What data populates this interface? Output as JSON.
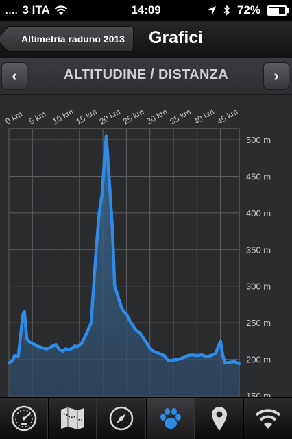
{
  "status": {
    "carrier": "3 ITA",
    "signal_dots": "....",
    "time": "14:09",
    "battery": "72%",
    "battery_level": 0.72
  },
  "navbar": {
    "back_label": "Altimetria raduno 2013",
    "title": "Grafici"
  },
  "chart_header": {
    "title": "ALTITUDINE / DISTANZA",
    "prev_icon": "chevron-left-icon",
    "next_icon": "chevron-right-icon"
  },
  "chart_data": {
    "type": "area",
    "title": "ALTITUDINE / DISTANZA",
    "xlabel": "",
    "ylabel": "",
    "xlim": [
      0,
      49
    ],
    "ylim": [
      150,
      515
    ],
    "x_ticks": [
      "0 km",
      "5 km",
      "10 km",
      "15 km",
      "20 km",
      "25 km",
      "30 km",
      "35 km",
      "40 km",
      "45 km"
    ],
    "y_ticks": [
      "500 m",
      "450 m",
      "400 m",
      "350 m",
      "300 m",
      "250 m",
      "200 m",
      "150 m"
    ],
    "grid": true,
    "line_color": "#2f8be8",
    "series": [
      {
        "x": [
          0,
          0.8,
          1.2,
          2,
          3,
          3.3,
          3.8,
          4.3,
          4.8,
          5.5,
          6,
          7,
          8,
          9,
          10,
          10.8,
          11.5,
          12,
          13,
          14,
          14.5,
          15.5,
          16.5,
          17.5,
          18.5,
          19.2,
          19.8,
          20.3,
          20.7,
          21,
          21.5,
          22,
          22.5,
          23,
          23.5,
          24,
          24.5,
          25,
          25.5,
          26,
          26.5,
          27,
          28,
          29,
          30,
          31,
          32,
          33,
          34,
          35,
          36,
          37,
          38,
          39,
          40,
          41,
          42,
          43,
          44,
          45,
          45.5,
          46,
          47,
          48,
          49
        ],
        "values": [
          195,
          198,
          205,
          204,
          262,
          265,
          228,
          224,
          222,
          220,
          218,
          216,
          214,
          217,
          220,
          213,
          211,
          214,
          213,
          218,
          217,
          222,
          235,
          250,
          345,
          400,
          425,
          470,
          505,
          480,
          430,
          380,
          300,
          290,
          280,
          270,
          265,
          262,
          255,
          250,
          245,
          240,
          235,
          225,
          215,
          210,
          208,
          205,
          198,
          199,
          200,
          202,
          205,
          206,
          205,
          206,
          204,
          205,
          208,
          225,
          205,
          195,
          196,
          197,
          194
        ]
      }
    ]
  },
  "tabs": [
    {
      "icon": "speedometer-icon",
      "active": false
    },
    {
      "icon": "map-icon",
      "active": false
    },
    {
      "icon": "compass-icon",
      "active": false
    },
    {
      "icon": "paw-icon",
      "active": true
    },
    {
      "icon": "location-pin-icon",
      "active": false
    },
    {
      "icon": "wifi-icon",
      "active": false
    }
  ]
}
